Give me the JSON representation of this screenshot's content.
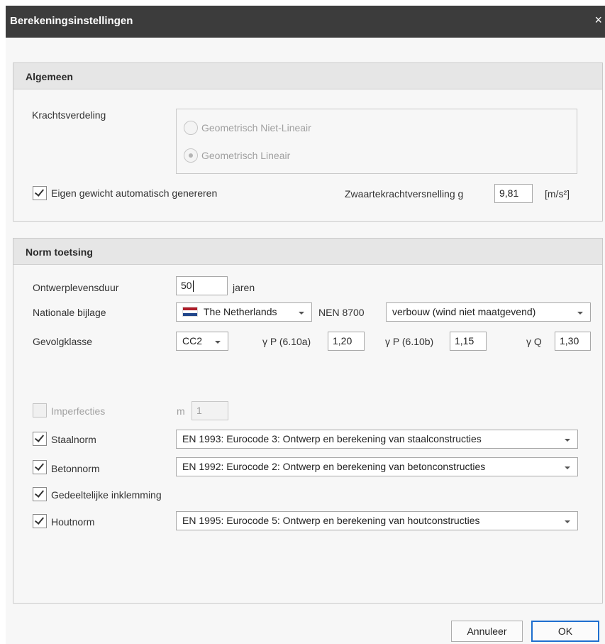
{
  "window": {
    "title": "Berekeningsinstellingen",
    "close_label": "×"
  },
  "algemeen": {
    "header": "Algemeen",
    "krachtsverdeling_label": "Krachtsverdeling",
    "radio_options": [
      {
        "label": "Geometrisch Niet-Lineair",
        "selected": false
      },
      {
        "label": "Geometrisch Lineair",
        "selected": true
      }
    ],
    "eigen_gewicht": {
      "label": "Eigen gewicht automatisch genereren",
      "checked": true
    },
    "zwaartekracht": {
      "label": "Zwaartekrachtversnelling g",
      "value": "9,81",
      "unit": "[m/s²]"
    }
  },
  "norm": {
    "header": "Norm toetsing",
    "ontwerplevensduur": {
      "label": "Ontwerplevensduur",
      "value": "50",
      "unit": "jaren"
    },
    "nationale_bijlage": {
      "label": "Nationale bijlage",
      "country": "The Netherlands",
      "code": "NEN 8700",
      "option": "verbouw (wind niet maatgevend)"
    },
    "gevolgklasse": {
      "label": "Gevolgklasse",
      "value": "CC2",
      "gp_a_label": "γ P (6.10a)",
      "gp_a_value": "1,20",
      "gp_b_label": "γ P (6.10b)",
      "gp_b_value": "1,15",
      "gq_label": "γ Q",
      "gq_value": "1,30"
    },
    "imperfecties": {
      "label": "Imperfecties",
      "checked": false,
      "m_label": "m",
      "m_value": "1"
    },
    "staalnorm": {
      "label": "Staalnorm",
      "checked": true,
      "value": "EN 1993: Eurocode 3: Ontwerp en berekening van staalconstructies"
    },
    "betonnorm": {
      "label": "Betonnorm",
      "checked": true,
      "value": "EN 1992: Eurocode 2: Ontwerp en berekening van betonconstructies"
    },
    "gedeeltelijke": {
      "label": "Gedeeltelijke inklemming",
      "checked": true
    },
    "houtnorm": {
      "label": "Houtnorm",
      "checked": true,
      "value": "EN 1995: Eurocode 5: Ontwerp en berekening van houtconstructies"
    }
  },
  "buttons": {
    "cancel": "Annuleer",
    "ok": "OK"
  },
  "colors": {
    "titlebar": "#3c3c3c",
    "accent": "#1f6fcf",
    "flag_red": "#ae1c28",
    "flag_white": "#ffffff",
    "flag_blue": "#21468b"
  }
}
